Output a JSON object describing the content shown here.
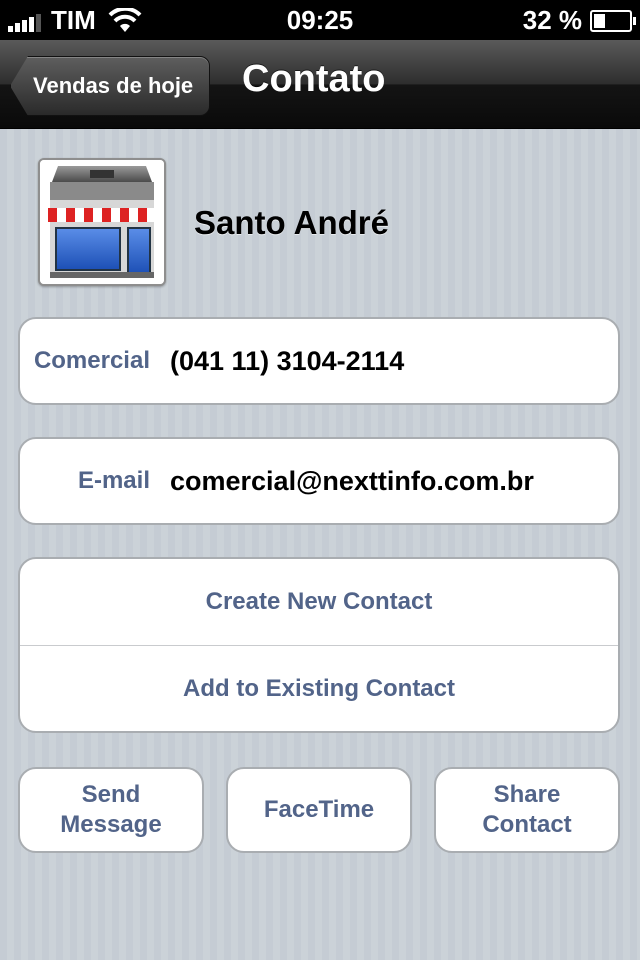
{
  "status_bar": {
    "carrier": "TIM",
    "time": "09:25",
    "battery_percent": "32 %",
    "battery_level": 0.32,
    "signal_bars": 4
  },
  "nav_bar": {
    "back_label": "Vendas de hoje",
    "title": "Contato"
  },
  "contact": {
    "name": "Santo André",
    "photo_icon": "store-icon"
  },
  "fields": [
    {
      "label": "Comercial",
      "value": "(041 11) 3104-2114"
    },
    {
      "label": "E-mail",
      "value": "comercial@nexttinfo.com.br"
    }
  ],
  "actions": {
    "create_new": "Create New Contact",
    "add_existing": "Add to Existing Contact"
  },
  "buttons": {
    "send_message": "Send\nMessage",
    "facetime": "FaceTime",
    "share_contact": "Share\nContact"
  },
  "colors": {
    "label_blue": "#526489",
    "background": "#c5ccd4",
    "nav_bar": "#1c1c1c"
  }
}
